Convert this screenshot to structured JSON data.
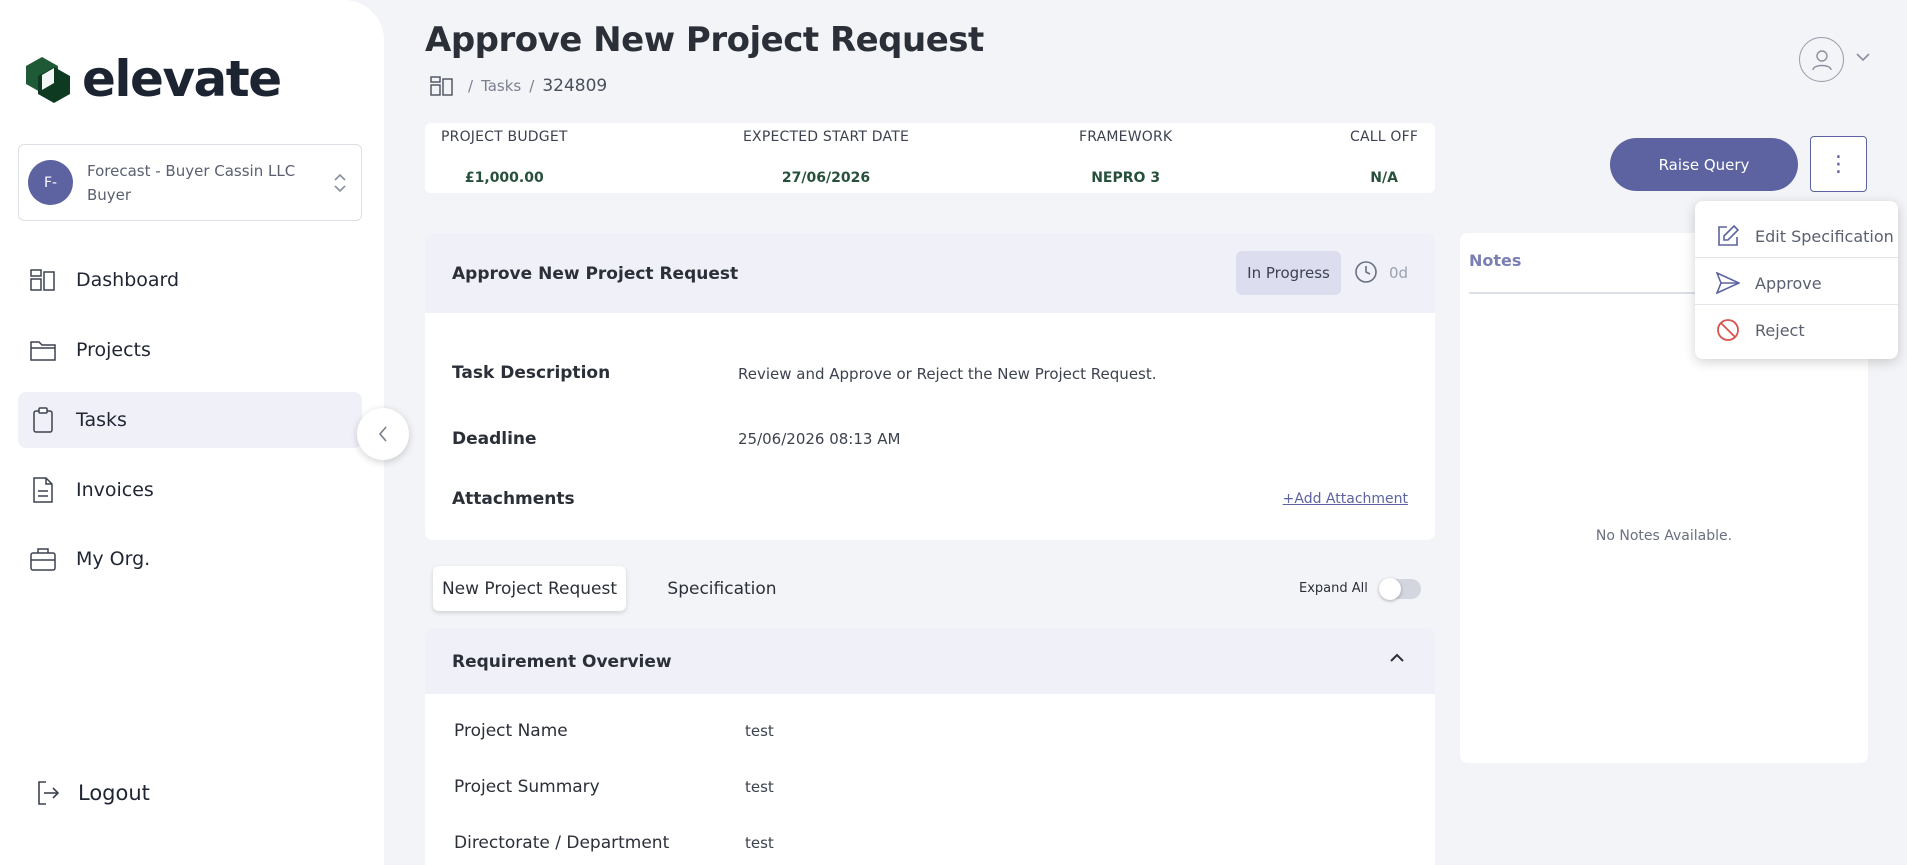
{
  "brand": {
    "name": "elevate"
  },
  "org": {
    "initials": "F-",
    "name": "Forecast - Buyer Cassin LLC",
    "role": "Buyer"
  },
  "nav": [
    {
      "label": "Dashboard",
      "icon": "dashboard-icon"
    },
    {
      "label": "Projects",
      "icon": "folder-icon"
    },
    {
      "label": "Tasks",
      "icon": "clipboard-icon",
      "active": true
    },
    {
      "label": "Invoices",
      "icon": "document-icon"
    },
    {
      "label": "My Org.",
      "icon": "briefcase-icon"
    }
  ],
  "logout": {
    "label": "Logout"
  },
  "header": {
    "title": "Approve New Project Request",
    "breadcrumb": {
      "tasks": "Tasks",
      "id": "324809"
    }
  },
  "stats": {
    "budget": {
      "label": "PROJECT BUDGET",
      "value": "£1,000.00"
    },
    "start": {
      "label": "EXPECTED START DATE",
      "value": "27/06/2026"
    },
    "framework": {
      "label": "FRAMEWORK",
      "value": "NEPRO 3"
    },
    "calloff": {
      "label": "CALL OFF",
      "value": "N/A"
    }
  },
  "actions": {
    "raise_query": "Raise Query",
    "kebab": "⋮"
  },
  "task": {
    "title": "Approve New Project Request",
    "status": "In Progress",
    "days": "0d",
    "description_label": "Task Description",
    "description": "Review and Approve or Reject the New Project Request.",
    "deadline_label": "Deadline",
    "deadline": "25/06/2026 08:13 AM",
    "attachments_label": "Attachments",
    "add_attachment": "+Add Attachment"
  },
  "tabs": [
    {
      "label": "New Project Request",
      "active": true
    },
    {
      "label": "Specification",
      "active": false
    }
  ],
  "expand_all": {
    "label": "Expand All",
    "on": false
  },
  "requirement": {
    "title": "Requirement Overview",
    "rows": [
      {
        "label": "Project Name",
        "value": "test"
      },
      {
        "label": "Project Summary",
        "value": "test"
      },
      {
        "label": "Directorate / Department",
        "value": "test"
      }
    ]
  },
  "notes": {
    "title": "Notes",
    "empty": "No Notes Available."
  },
  "menu": [
    {
      "label": "Edit Specification",
      "icon": "edit-icon"
    },
    {
      "label": "Approve",
      "icon": "send-icon"
    },
    {
      "label": "Reject",
      "icon": "ban-icon"
    }
  ],
  "colors": {
    "accent": "#5d63a1",
    "brand_green": "#1f5a36",
    "reject_red": "#d9534f"
  }
}
